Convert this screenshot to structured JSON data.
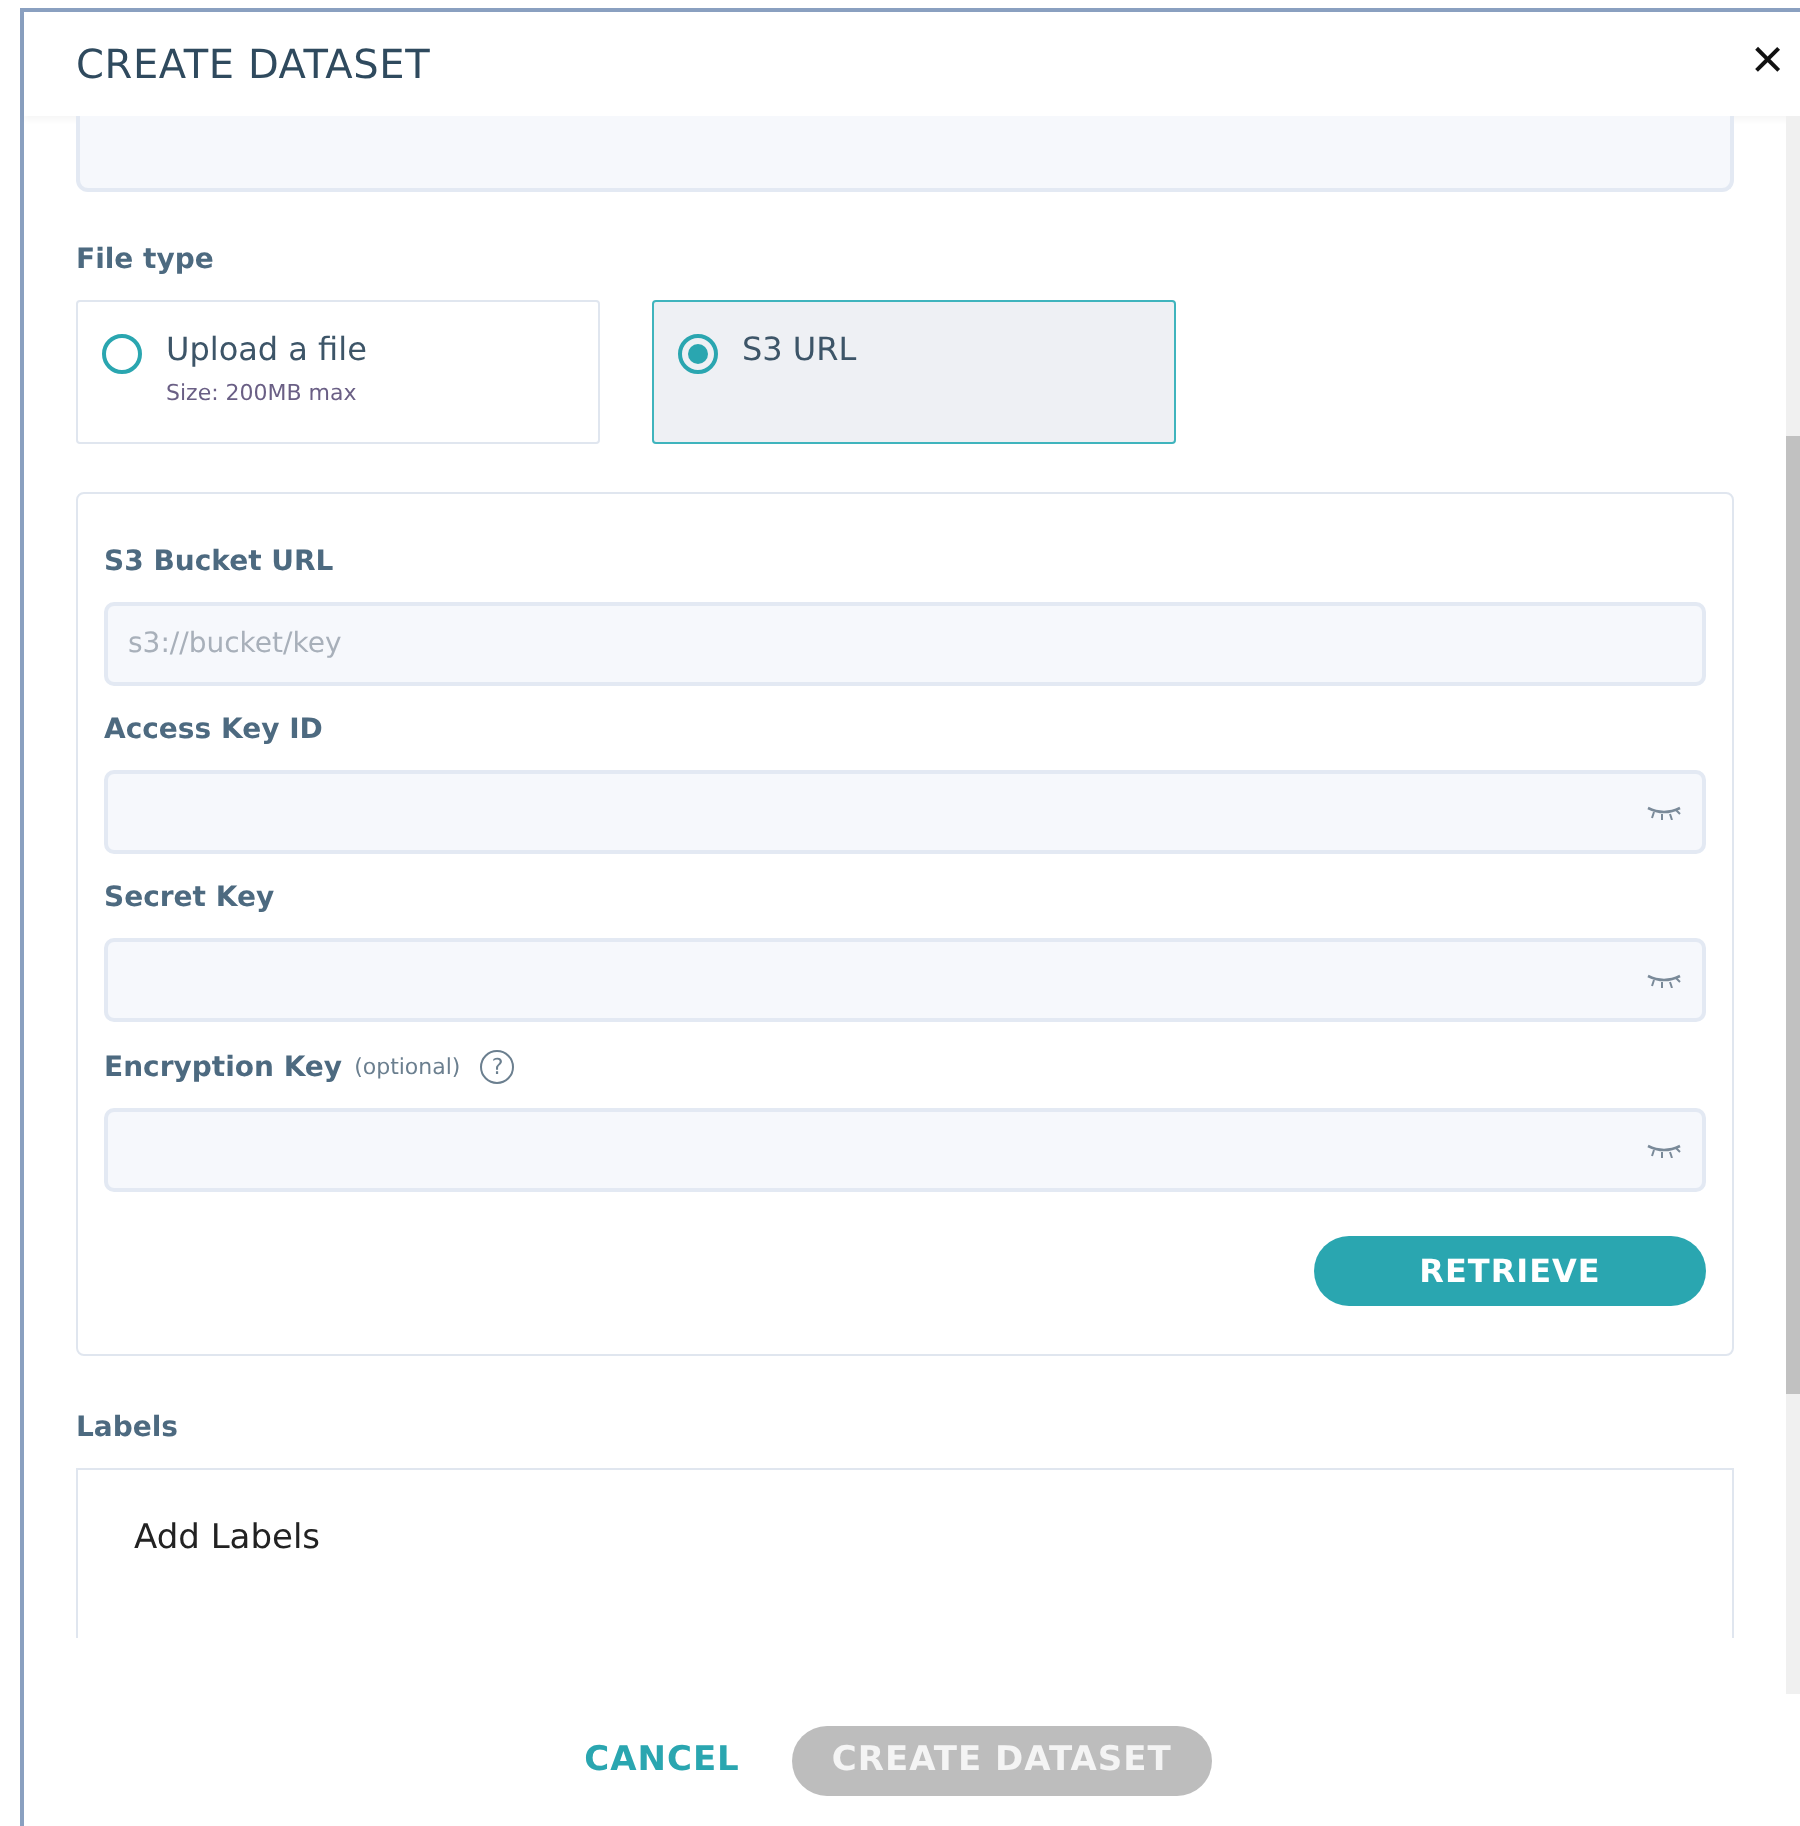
{
  "dialog": {
    "title": "CREATE DATASET",
    "close": "×"
  },
  "file_type": {
    "label": "File type",
    "options": [
      {
        "label": "Upload a file",
        "note": "Size: 200MB max",
        "selected": false
      },
      {
        "label": "S3 URL",
        "selected": true
      }
    ]
  },
  "s3_fields": [
    {
      "kind": "text",
      "label": "S3 Bucket URL",
      "placeholder": "s3://bucket/key"
    },
    {
      "kind": "secret",
      "label": "Access Key ID"
    },
    {
      "kind": "secret",
      "label": "Secret Key"
    },
    {
      "kind": "secret",
      "label": "Encryption Key",
      "note": "(optional)",
      "help": "?"
    }
  ],
  "retrieve_button": "RETRIEVE",
  "labels": {
    "label": "Labels",
    "add": "Add Labels"
  },
  "footer": {
    "cancel": "CANCEL",
    "create": {
      "label": "CREATE DATASET",
      "disabled": true
    }
  }
}
